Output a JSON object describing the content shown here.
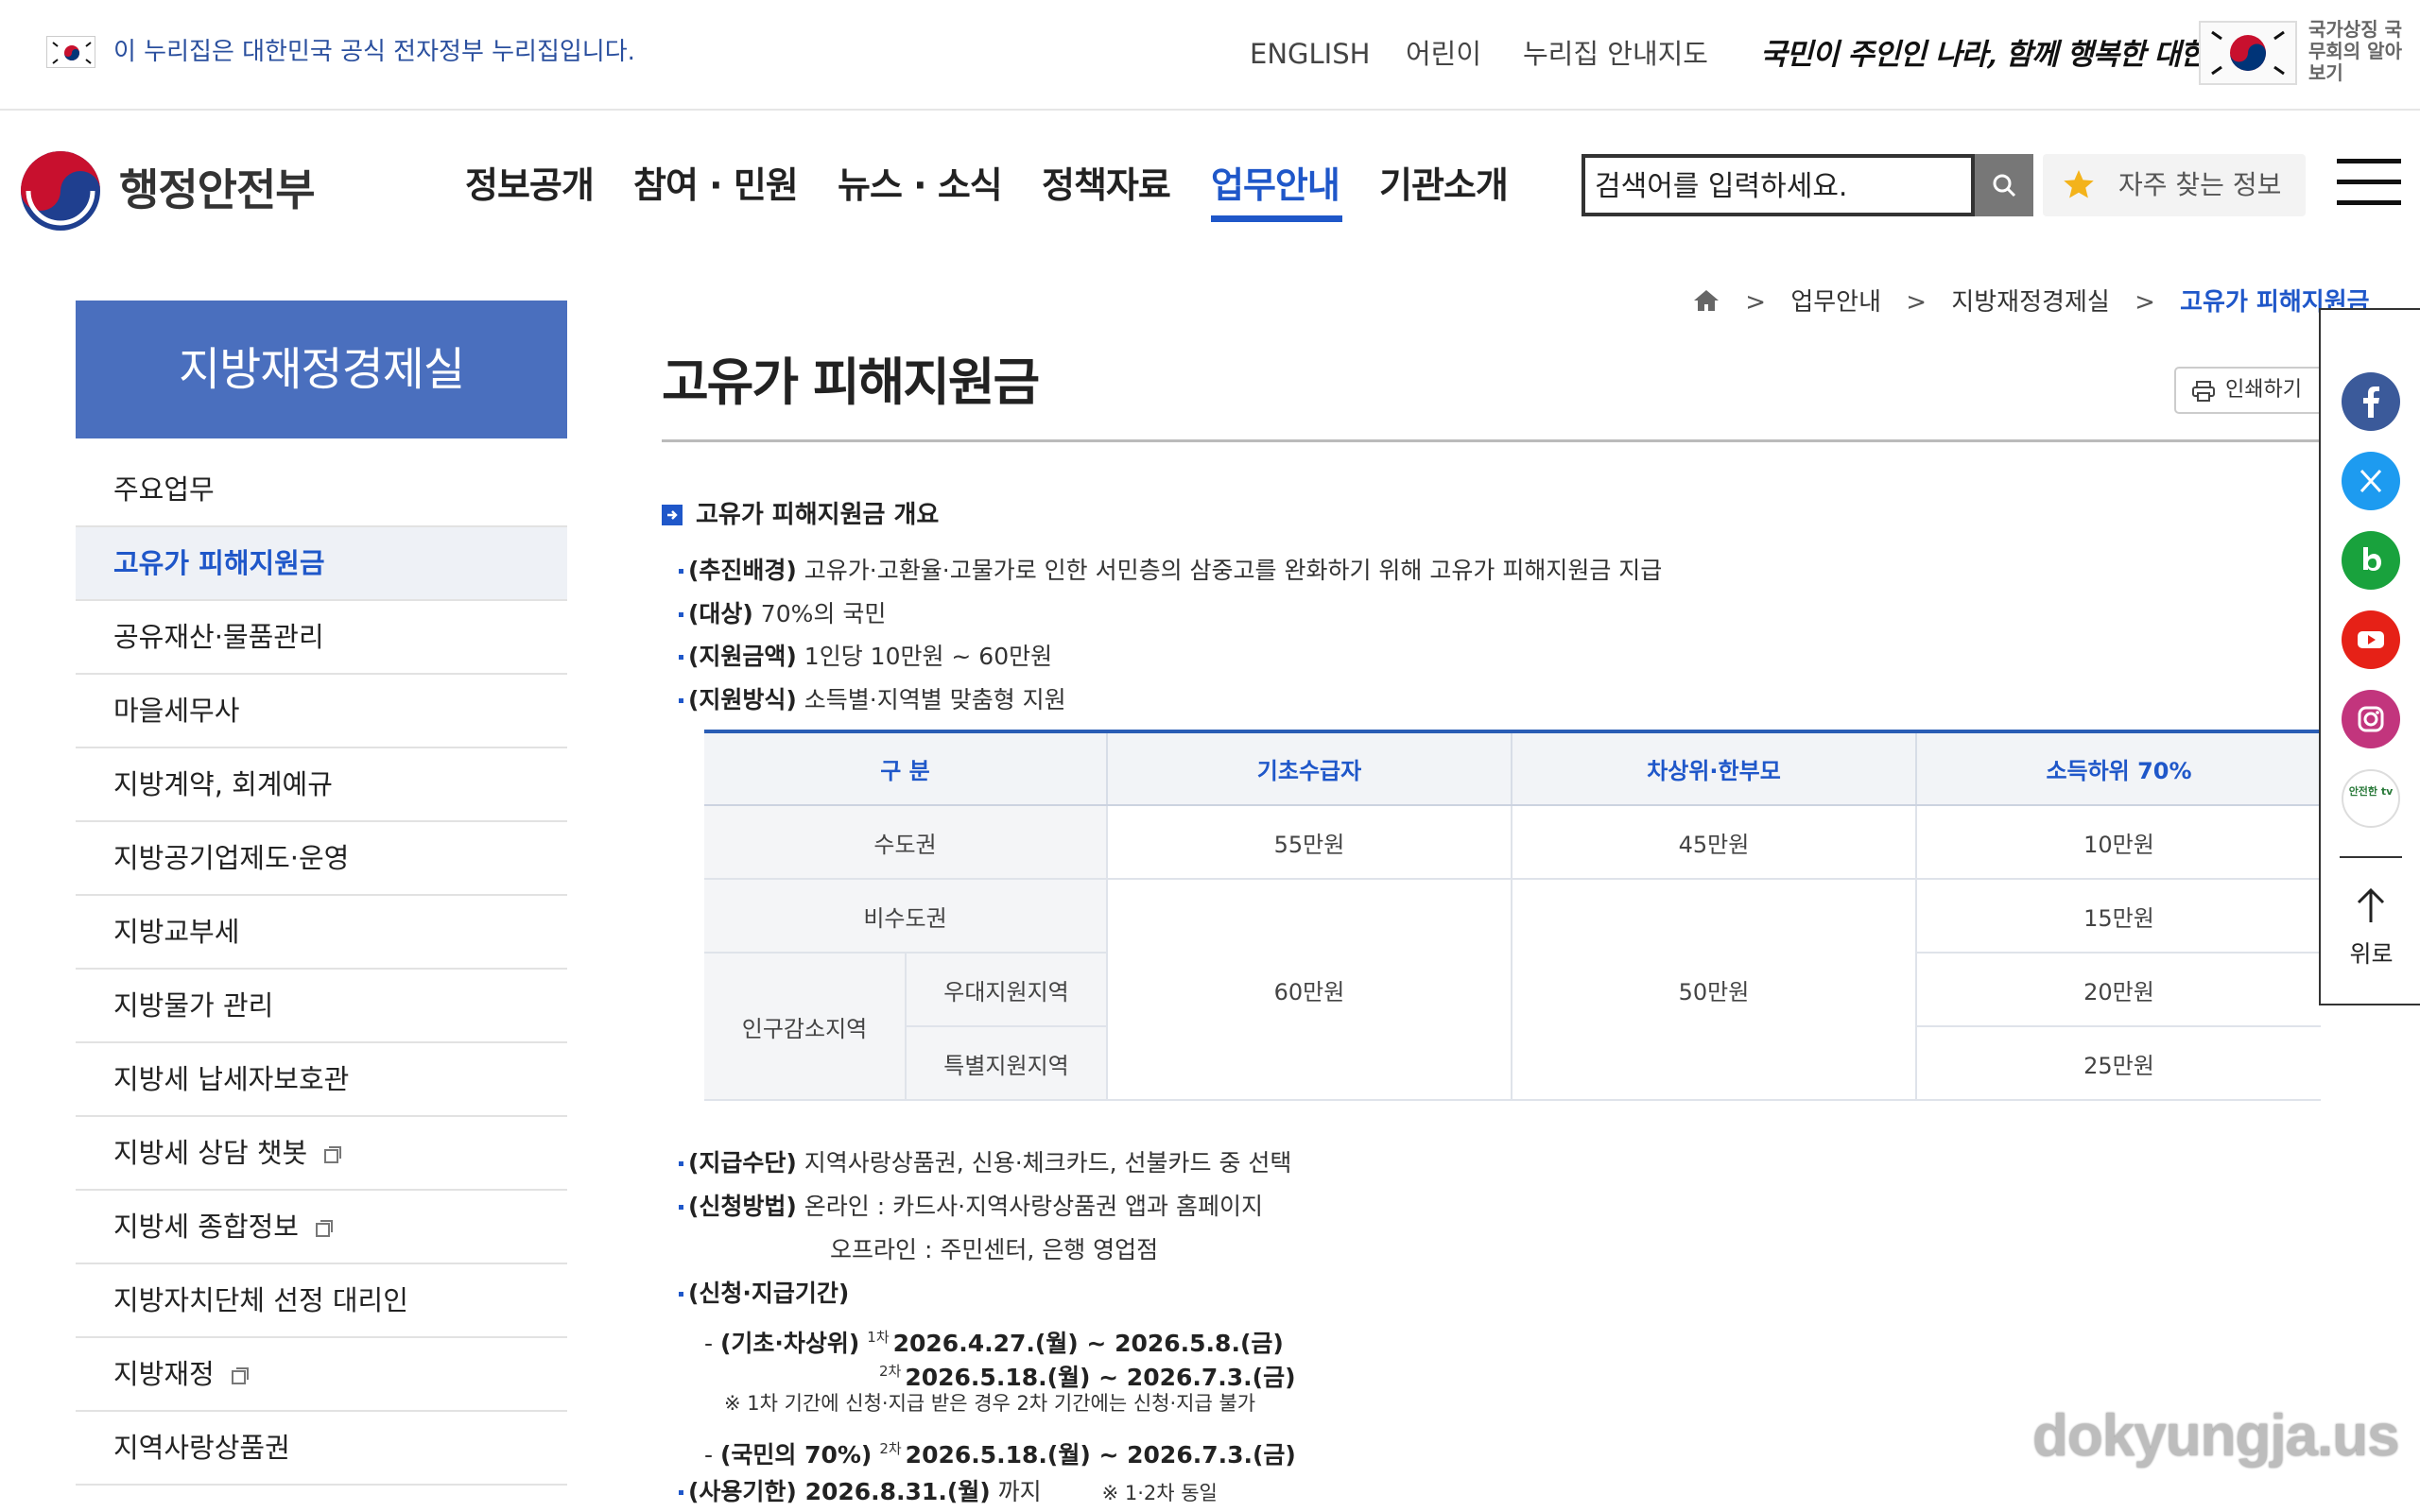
{
  "topbar": {
    "gov_notice": "이 누리집은 대한민국 공식 전자정부 누리집입니다.",
    "links": [
      "ENGLISH",
      "어린이",
      "누리집 안내지도"
    ],
    "slogan": "국민이 주인인 나라, 함께 행복한 대한민국",
    "national_text": "국가상징 국무회의 알아보기"
  },
  "header": {
    "brand": "행정안전부",
    "gnb": [
      {
        "label": "정보공개"
      },
      {
        "label": "참여 · 민원"
      },
      {
        "label": "뉴스 · 소식"
      },
      {
        "label": "정책자료"
      },
      {
        "label": "업무안내",
        "active": true
      },
      {
        "label": "기관소개"
      }
    ],
    "search_placeholder": "검색어를 입력하세요.",
    "favorites_label": "자주 찾는 정보"
  },
  "lnb": {
    "title": "지방재정경제실",
    "items": [
      {
        "label": "주요업무"
      },
      {
        "label": "고유가 피해지원금",
        "active": true
      },
      {
        "label": "공유재산·물품관리"
      },
      {
        "label": "마을세무사"
      },
      {
        "label": "지방계약, 회계예규"
      },
      {
        "label": "지방공기업제도·운영"
      },
      {
        "label": "지방교부세"
      },
      {
        "label": "지방물가 관리"
      },
      {
        "label": "지방세 납세자보호관"
      },
      {
        "label": "지방세 상담 챗봇",
        "external": true
      },
      {
        "label": "지방세 종합정보",
        "external": true
      },
      {
        "label": "지방자치단체 선정 대리인"
      },
      {
        "label": "지방재정",
        "external": true
      },
      {
        "label": "지역사랑상품권"
      }
    ]
  },
  "breadcrumb": [
    "업무안내",
    "지방재정경제실",
    "고유가 피해지원금"
  ],
  "page": {
    "title": "고유가 피해지원금",
    "print_label": "인쇄하기",
    "section_heading": "고유가 피해지원금 개요",
    "bullets_top": [
      {
        "key": "(추진배경)",
        "text": " 고유가·고환율·고물가로 인한 서민층의 삼중고를 완화하기 위해 고유가 피해지원금 지급"
      },
      {
        "key": "(대상)",
        "text": " 70%의 국민"
      },
      {
        "key": "(지원금액)",
        "text": " 1인당 10만원 ~ 60만원"
      },
      {
        "key": "(지원방식)",
        "text": " 소득별·지역별 맞춤형 지원"
      }
    ],
    "table": {
      "headers": [
        "구   분",
        "기초수급자",
        "차상위·한부모",
        "소득하위 70%"
      ],
      "capital": "수도권",
      "non_capital": "비수도권",
      "pop_decline": "인구감소지역",
      "priority": "우대지원지역",
      "special": "특별지원지역",
      "basic_capital": "55만원",
      "near_capital": "45만원",
      "basic_other": "60만원",
      "near_other": "50만원",
      "low_capital": "10만원",
      "low_non_capital": "15만원",
      "low_priority": "20만원",
      "low_special": "25만원"
    },
    "pay_method_key": "(지급수단)",
    "pay_method_text": " 지역사랑상품권, 신용·체크카드, 선불카드 중 선택",
    "apply_method_key": "(신청방법)",
    "apply_method_online": " 온라인 : 카드사·지역사랑상품권 앱과 홈페이지",
    "apply_method_offline": "오프라인 : 주민센터, 은행 영업점",
    "period_key": "(신청·지급기간)",
    "period_line1_prefix": "- ",
    "period_line1_key": "(기초·차상위)",
    "round1": "1차",
    "round2": "2차",
    "period_r1": "2026.4.27.(월) ~ 2026.5.8.(금)",
    "period_r2": "2026.5.18.(월) ~ 2026.7.3.(금)",
    "period_note": "※ 1차 기간에 신청·지급 받은 경우 2차 기간에는 신청·지급 불가",
    "period_line3_key": "(국민의 70%)",
    "usage_key": "(사용기한)",
    "usage_date": " 2026.8.31.(월)",
    "usage_tail": " 까지",
    "usage_note": "※ 1·2차 동일"
  },
  "sns": {
    "colors": {
      "facebook": "#3b5a9a",
      "x": "#1d9bf0",
      "blog": "#19a23d",
      "youtube": "#e62117",
      "instagram": "#c2357d",
      "tv": "#ffffff"
    },
    "tv_label": "안전한 tv",
    "top_label": "위로"
  },
  "watermark": "dokyungja.us",
  "theme": {
    "accent": "#1f57c9",
    "lnb_bg": "#4a6fbe"
  }
}
